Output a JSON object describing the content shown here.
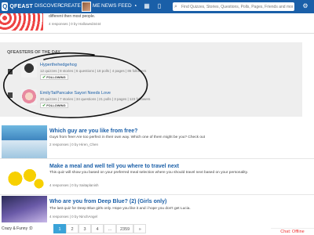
{
  "topbar": {
    "logo_letter": "Q",
    "logo_text": "QFEAST",
    "nav": [
      "DISCOVER",
      "CREATE",
      "ME",
      "NEWS FEED"
    ],
    "search_placeholder": "Find Quizzes, Stories, Questions, Polls, Pages, Friends and more",
    "colors": {
      "bar": "#1a5fa8",
      "text": "#ffffff"
    }
  },
  "top_card": {
    "description": "different then most people.",
    "meta": "4 responses  |  0  by Hallowed4444"
  },
  "featured": {
    "title": "QFEASTERS OF THE DAY",
    "users": [
      {
        "name": "Hyperthehedgehog",
        "stats": "12 quizzes | 8 stories | 6 questions | 18 polls | 4 pages | 86 followers",
        "follow_label": "FOLLOWING"
      },
      {
        "name": "EmilyTaiPancake Sayori Needs Love",
        "stats": "20 quizzes | 7 stories | 34 questions | 21 polls | 3 pages | 123 followers",
        "follow_label": "FOLLOWING"
      }
    ]
  },
  "quizzes": [
    {
      "title": "Which guy are you like from free?",
      "description": "Guys from free! Are too perfect in their own way. Which one of them might be you? Check out",
      "meta": "2 responses  |  0  by Hiren_Chen"
    },
    {
      "title": "Make a meal and well tell you where to travel next",
      "description": "This quiz will show you based on your preferred meal selection where you should travel next based on your personality.",
      "meta": "4 responses  |  0  by Saitaplanish"
    },
    {
      "title": "Who are you from Deep Blue? (2) (Girls only)",
      "description": "The last quiz for Deep Blue girls only. Hope you like it and i hope you don't get Lucia.",
      "meta": "4 responses  |  0  by NinchAngel"
    }
  ],
  "pagination": [
    "1",
    "2",
    "3",
    "4",
    "...",
    "2359",
    "»"
  ],
  "pagination_active": "1",
  "side_label": "Crazy & Funny :D",
  "chat_label": "Chat: Offline"
}
